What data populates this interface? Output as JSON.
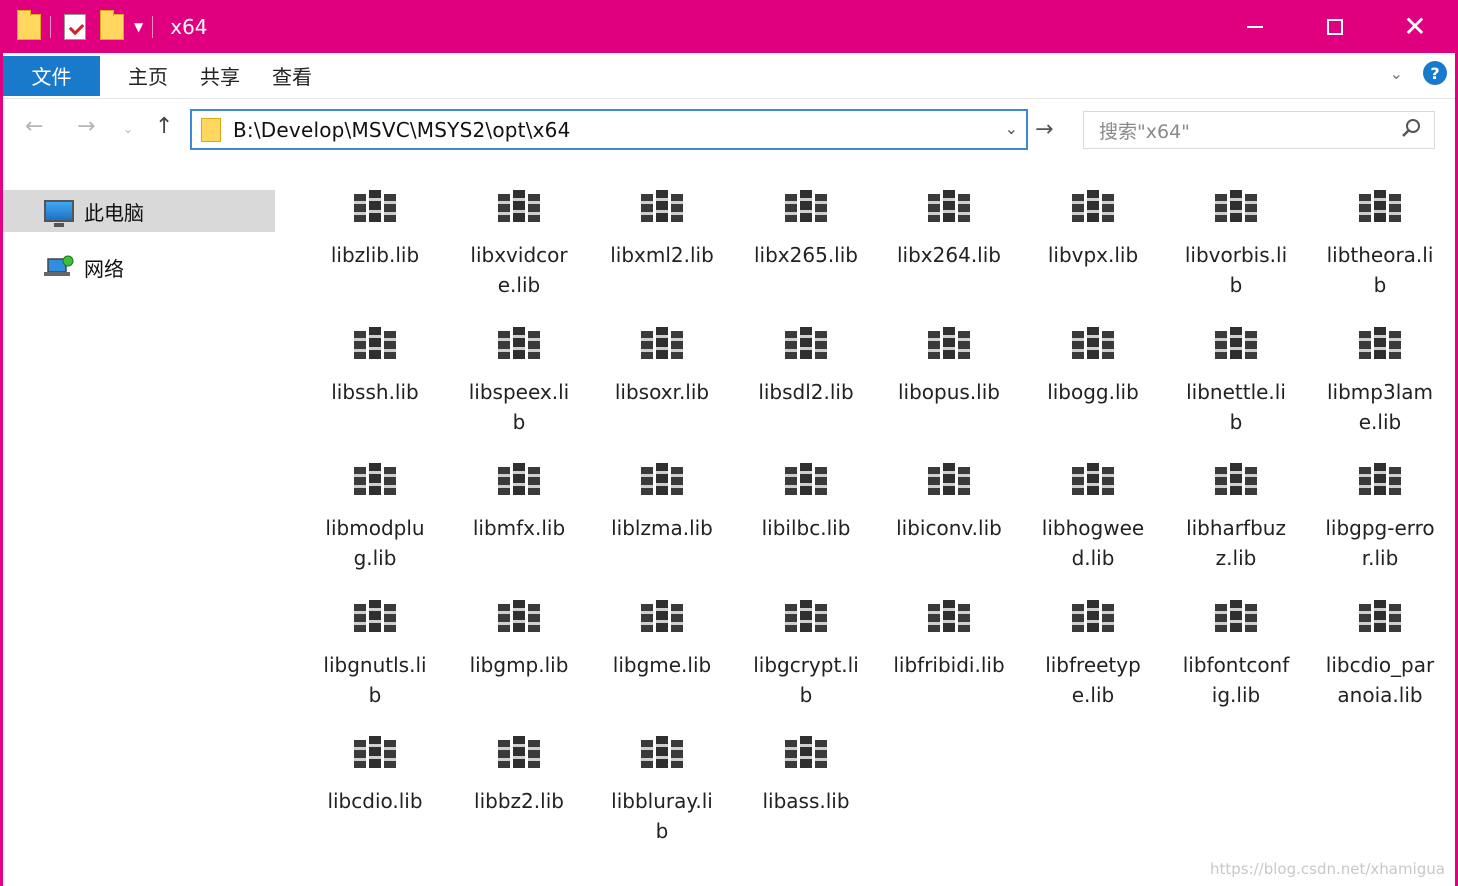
{
  "window": {
    "title": "x64",
    "accent_color": "#e0007f",
    "controls": {
      "minimize": "minimize-icon",
      "maximize": "maximize-icon",
      "close": "close-icon"
    }
  },
  "ribbon": {
    "file_tab": "文件",
    "tabs": [
      "主页",
      "共享",
      "查看"
    ]
  },
  "address": {
    "path": "B:\\Develop\\MSVC\\MSYS2\\opt\\x64",
    "search_placeholder": "搜索\"x64\""
  },
  "sidebar": {
    "items": [
      {
        "label": "此电脑",
        "icon": "computer-icon",
        "selected": true
      },
      {
        "label": "网络",
        "icon": "network-icon",
        "selected": false
      }
    ]
  },
  "files": [
    "libzlib.lib",
    "libxvidcore.lib",
    "libxml2.lib",
    "libx265.lib",
    "libx264.lib",
    "libvpx.lib",
    "libvorbis.lib",
    "libtheora.lib",
    "libssh.lib",
    "libspeex.lib",
    "libsoxr.lib",
    "libsdl2.lib",
    "libopus.lib",
    "libogg.lib",
    "libnettle.lib",
    "libmp3lame.lib",
    "libmodplug.lib",
    "libmfx.lib",
    "liblzma.lib",
    "libilbc.lib",
    "libiconv.lib",
    "libhogweed.lib",
    "libharfbuzz.lib",
    "libgpg-error.lib",
    "libgnutls.lib",
    "libgmp.lib",
    "libgme.lib",
    "libgcrypt.lib",
    "libfribidi.lib",
    "libfreetype.lib",
    "libfontconfig.lib",
    "libcdio_paranoia.lib",
    "libcdio.lib",
    "libbz2.lib",
    "libbluray.lib",
    "libass.lib"
  ],
  "watermark": "https://blog.csdn.net/xhamigua"
}
